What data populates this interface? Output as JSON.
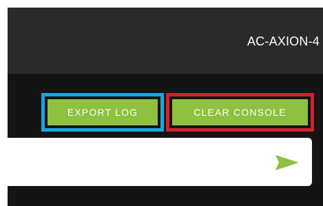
{
  "header": {
    "device_name": "AC-AXION-4"
  },
  "actions": {
    "export_log_label": "EXPORT LOG",
    "clear_console_label": "CLEAR CONSOLE"
  },
  "command_bar": {
    "input_value": "",
    "send_icon": "send-arrow-icon"
  },
  "colors": {
    "button_green": "#8dc13f",
    "export_highlight": "#1aa6e0",
    "clear_highlight": "#d1202f",
    "panel_dark": "#141414",
    "header_dark": "#2a2a2a"
  }
}
